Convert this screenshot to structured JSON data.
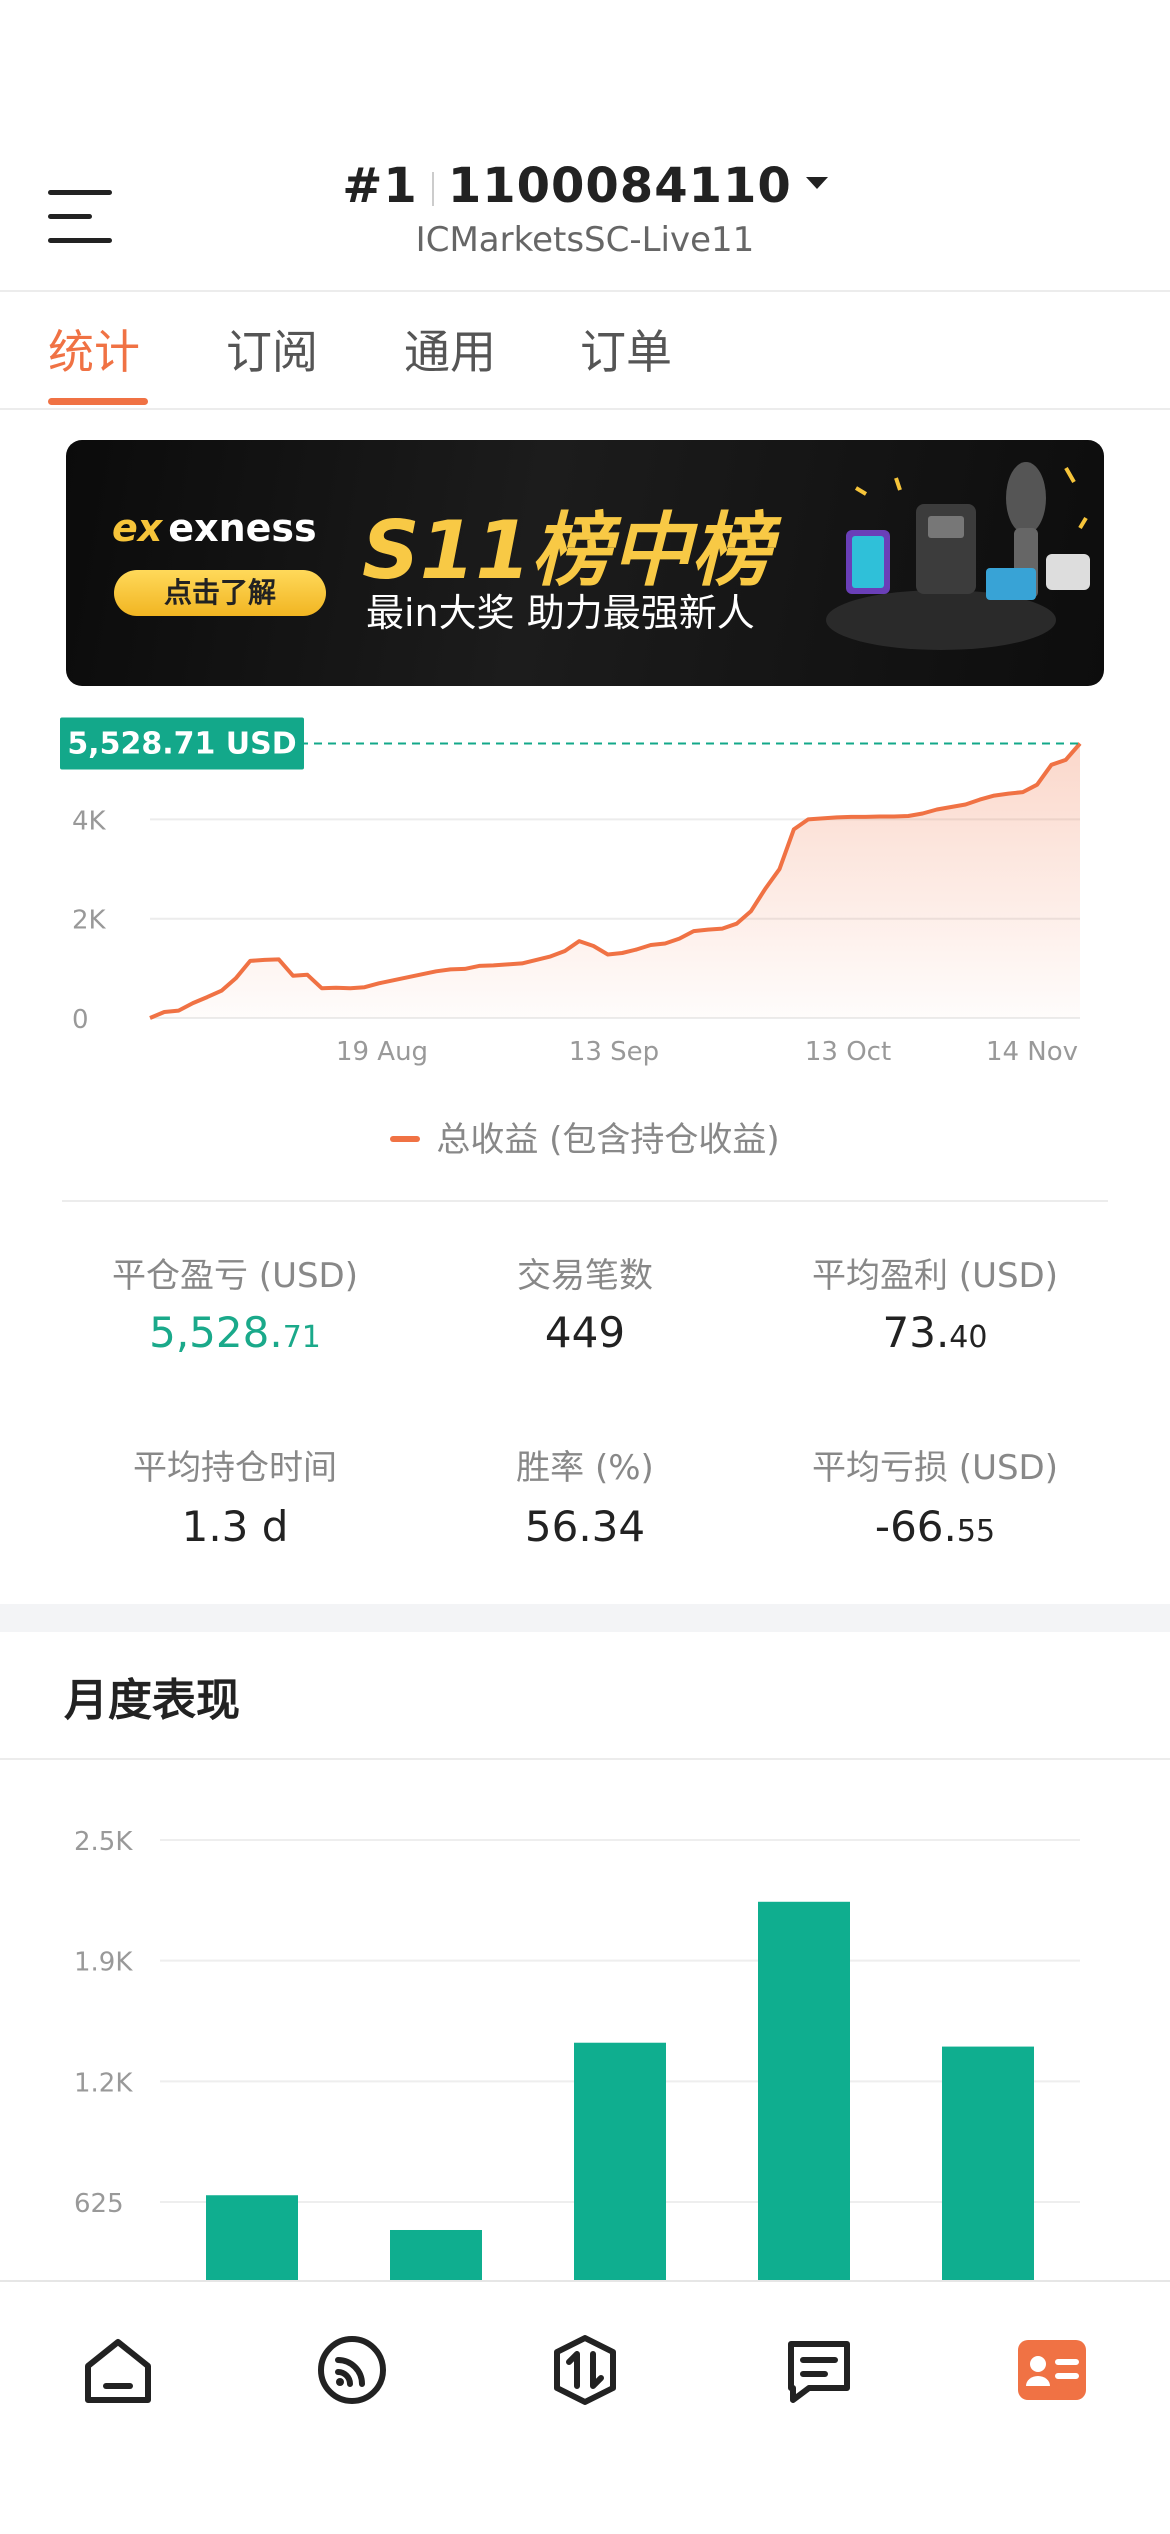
{
  "header": {
    "rank": "#1",
    "account": "1100084110",
    "server": "ICMarketsSC-Live11"
  },
  "tabs": [
    {
      "label": "统计",
      "active": true
    },
    {
      "label": "订阅",
      "active": false
    },
    {
      "label": "通用",
      "active": false
    },
    {
      "label": "订单",
      "active": false
    }
  ],
  "banner": {
    "brand": "exness",
    "cta": "点击了解",
    "headline": "S11榜中榜",
    "subline": "最in大奖 助力最强新人"
  },
  "equity_chart": {
    "current_label": "5,528.71 USD",
    "accent_color": "#f07244",
    "badge_color": "#13a88a",
    "legend": "总收益 (包含持仓收益)",
    "chart_data": {
      "type": "area",
      "ylim": [
        0,
        5600
      ],
      "y_ticks": [
        "0",
        "2K",
        "4K"
      ],
      "x_ticks": [
        "19 Aug",
        "13 Sep",
        "13 Oct",
        "14 Nov"
      ],
      "grid": true,
      "reference_line": 5528.71,
      "series": [
        {
          "name": "总收益 (包含持仓收益)",
          "values": [
            0,
            120,
            150,
            300,
            420,
            550,
            800,
            1150,
            1170,
            1180,
            850,
            870,
            600,
            610,
            600,
            620,
            700,
            760,
            820,
            880,
            940,
            980,
            990,
            1050,
            1060,
            1080,
            1100,
            1170,
            1240,
            1350,
            1550,
            1450,
            1280,
            1310,
            1380,
            1470,
            1500,
            1600,
            1750,
            1780,
            1800,
            1900,
            2150,
            2600,
            3000,
            3800,
            4000,
            4020,
            4040,
            4050,
            4050,
            4060,
            4060,
            4070,
            4120,
            4200,
            4250,
            4300,
            4400,
            4480,
            4520,
            4550,
            4700,
            5100,
            5200,
            5528.71
          ]
        }
      ]
    }
  },
  "stats": [
    {
      "label": "平仓盈亏 (USD)",
      "int": "5,528.",
      "dec": "71",
      "profit": true
    },
    {
      "label": "交易笔数",
      "int": "449",
      "dec": "",
      "profit": false
    },
    {
      "label": "平均盈利 (USD)",
      "int": "73.",
      "dec": "40",
      "profit": false
    },
    {
      "label": "平均持仓时间",
      "int": "1.3 d",
      "dec": "",
      "profit": false
    },
    {
      "label": "胜率 (%)",
      "int": "56.34",
      "dec": "",
      "profit": false
    },
    {
      "label": "平均亏损 (USD)",
      "int": "-66.",
      "dec": "55",
      "profit": false
    }
  ],
  "monthly": {
    "title": "月度表现",
    "chart_data": {
      "type": "bar",
      "y_ticks": [
        "625",
        "1.2K",
        "1.9K",
        "2.5K"
      ],
      "bar_color": "#0fae8f",
      "categories": [
        "",
        "",
        "",
        "",
        ""
      ],
      "values": [
        660,
        480,
        1450,
        2180,
        1430
      ],
      "grid": true
    }
  },
  "nav": [
    {
      "icon": "home-icon",
      "active": false
    },
    {
      "icon": "feed-icon",
      "active": false
    },
    {
      "icon": "trade-icon",
      "active": false
    },
    {
      "icon": "message-icon",
      "active": false
    },
    {
      "icon": "profile-card-icon",
      "active": true
    }
  ]
}
